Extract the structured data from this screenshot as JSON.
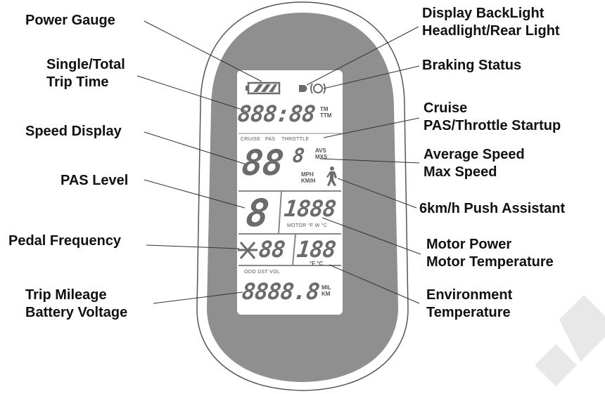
{
  "labels": {
    "power_gauge": "Power Gauge",
    "trip_time": [
      "Single/Total",
      "Trip Time"
    ],
    "speed_display": "Speed Display",
    "pas_level": "PAS Level",
    "pedal_frequency": "Pedal Frequency",
    "trip_mileage": [
      "Trip Mileage",
      "Battery Voltage"
    ],
    "backlight": [
      "Display BackLight",
      "Headlight/Rear Light"
    ],
    "braking_status": "Braking Status",
    "cruise": [
      "Cruise",
      "PAS/Throttle Startup"
    ],
    "avg_speed": [
      "Average Speed",
      "Max Speed"
    ],
    "push_assist": "6km/h Push Assistant",
    "motor_power": [
      "Motor Power",
      "Motor Temperature"
    ],
    "environment": [
      "Environment",
      "Temperature"
    ]
  },
  "lcd": {
    "time_digits": "888:88",
    "time_units": [
      "TM",
      "TTM"
    ],
    "mode_labels": [
      "CRUISE",
      "PAS",
      "THROTTLE"
    ],
    "speed_digits": "88",
    "speed_decimal": "8",
    "avs_mxs": [
      "AVS",
      "MXS"
    ],
    "speed_units": [
      "MPH",
      "KM/H"
    ],
    "pas_digit": "8",
    "motor_digits": "1888",
    "motor_units": "MOTOR °F W °C",
    "cadence_digits": "88",
    "temp_digits": "188",
    "temp_units": "°F  °C",
    "odo_labels": "ODO DST VOL",
    "odo_digits": "8888.8",
    "odo_units": [
      "MIL",
      "KM"
    ]
  },
  "colors": {
    "bezel": "#8f8f8f",
    "screen": "#ffffff",
    "segments": "#6b6b6b",
    "labels": "#111111",
    "leader_lines": "#333333"
  }
}
